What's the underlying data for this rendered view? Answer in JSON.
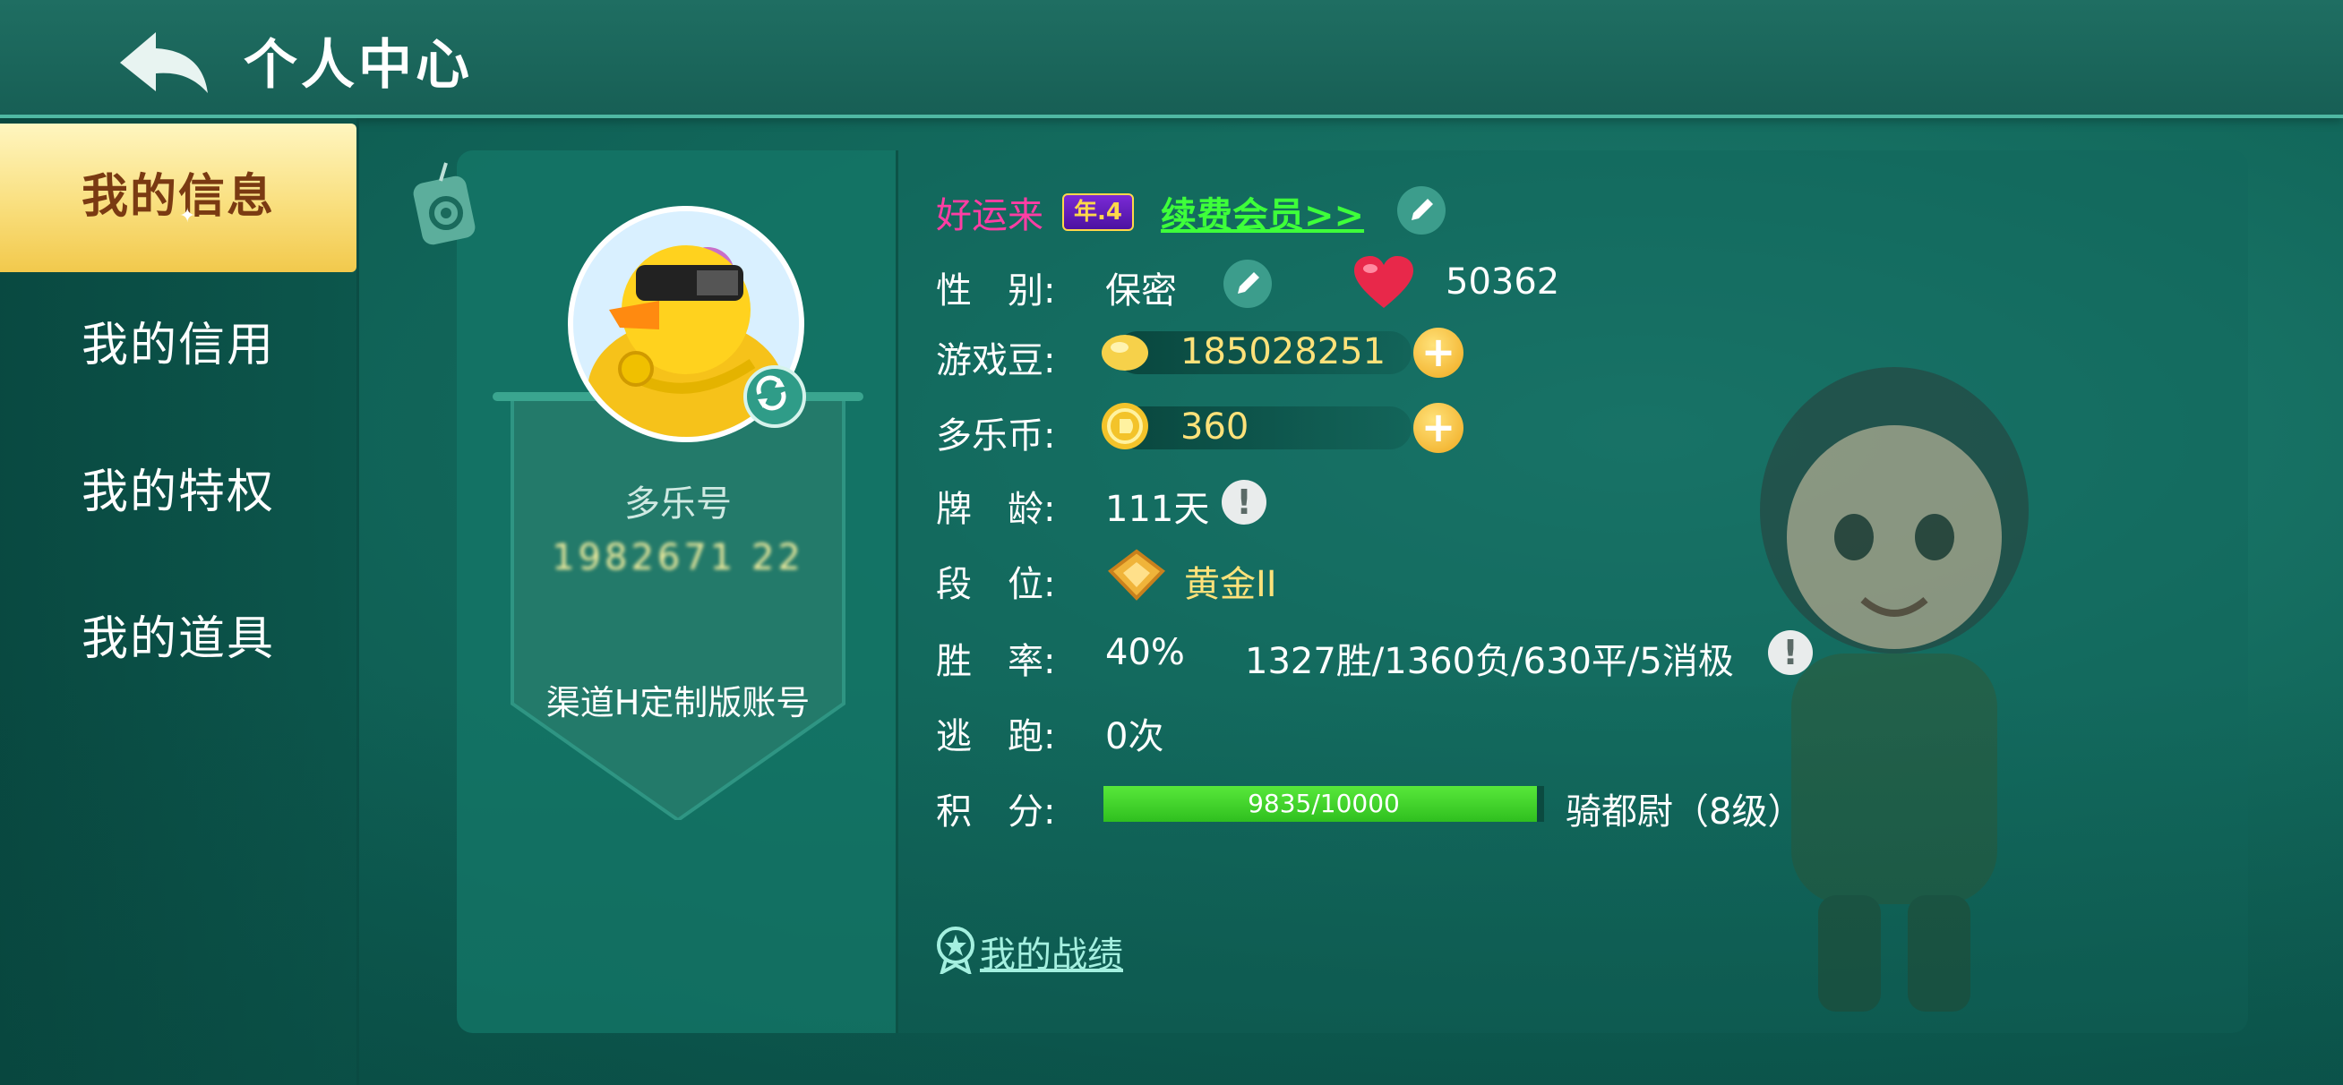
{
  "header": {
    "title": "个人中心"
  },
  "sidebar": {
    "items": [
      {
        "label": "我的信息",
        "active": true
      },
      {
        "label": "我的信用",
        "active": false
      },
      {
        "label": "我的特权",
        "active": false
      },
      {
        "label": "我的道具",
        "active": false
      }
    ]
  },
  "profile": {
    "account_label": "多乐号",
    "account_id": "1982671 22",
    "channel": "渠道H定制版账号"
  },
  "info": {
    "nickname": "好运来",
    "year_badge": "年.4",
    "renew_link": "续费会员>>",
    "gender": {
      "label": "性　别:",
      "value": "保密"
    },
    "likes": "50362",
    "beans": {
      "label": "游戏豆:",
      "value": "185028251"
    },
    "coins": {
      "label": "多乐币:",
      "value": "360"
    },
    "age": {
      "label": "牌　龄:",
      "value": "111天"
    },
    "rank": {
      "label": "段　位:",
      "value": "黄金II"
    },
    "winrate": {
      "label": "胜　率:",
      "value": "40%",
      "detail": "1327胜/1360负/630平/5消极"
    },
    "escape": {
      "label": "逃　跑:",
      "value": "0次"
    },
    "score": {
      "label": "积　分:",
      "value": "9835/10000",
      "fraction": 0.9835,
      "title": "骑都尉（8级）"
    },
    "record_link": "我的战绩"
  },
  "colors": {
    "accent_green": "#3eff3a",
    "nickname_pink": "#ff3da4",
    "gold": "#ffe27a",
    "active_tab": "#f9df7e"
  },
  "icons": [
    "back-arrow-icon",
    "tag-icon",
    "refresh-icon",
    "edit-icon",
    "heart-icon",
    "bean-icon",
    "coin-icon",
    "plus-icon",
    "info-icon",
    "rank-icon",
    "star-badge-icon"
  ]
}
